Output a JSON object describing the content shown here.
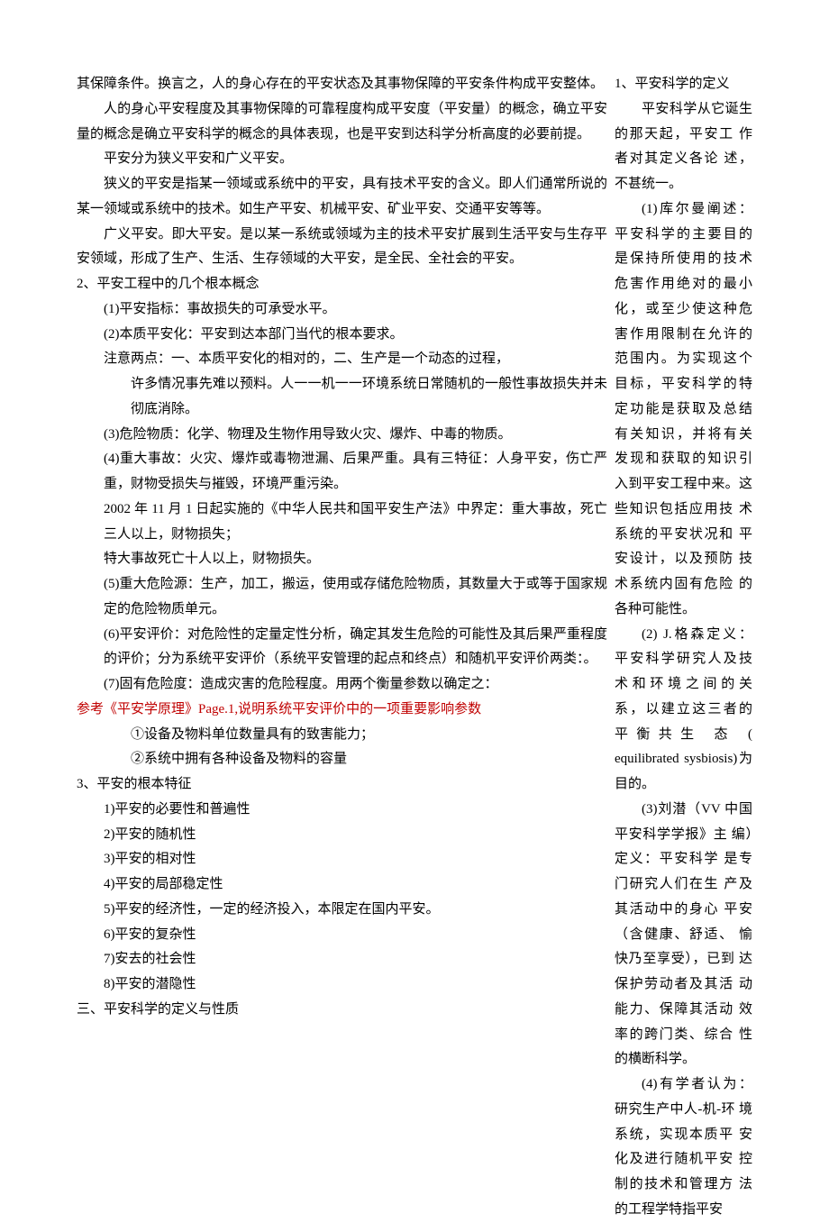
{
  "right": {
    "h1": "1、平安科学的定义",
    "p1": "平安科学从它诞生的那天起，平安工 作者对其定义各论 述，不甚统一。",
    "p2": "(1)库尔曼阐述： 平安科学的主要目的 是保持所使用的技术 危害作用绝对的最小 化，或至少使这种危 害作用限制在允许的 范围内。为实现这个 目标，平安科学的特 定功能是获取及总结 有关知识，并将有关 发现和获取的知识引 入到平安工程中来。这些知识包括应用技 术系统的平安状况和 平安设计，以及预防 技术系统内固有危险 的各种可能性。",
    "p3": "(2) J.格森定义： 平安科学研究人及技 术和环境之间的关 系，以建立这三者的 平衡共生 态 ( equilibrated sysbiosis)为目的。",
    "p4": "(3)刘潜（VV 中国 平安科学学报》主 编）定义：平安科学 是专门研究人们在生 产及其活动中的身心 平安（含健康、舒适、 愉快乃至享受），已到 达保护劳动者及其活 动能力、保障其活动 效率的跨门类、综合 性的横断科学。",
    "p5": "(4)有学者认为： 研究生产中人-机-环 境系统，实现本质平 安化及进行随机平安 控制的技术和管理方 法的工程学特指平安"
  },
  "left": {
    "p1": "其保障条件。换言之，人的身心存在的平安状态及其事物保障的平安条件构成平安整体。",
    "p2": "人的身心平安程度及其事物保障的可靠程度构成平安度（平安量）的概念，确立平安量的概念是确立平安科学的概念的具体表现，也是平安到达科学分析高度的必要前提。",
    "p3": "平安分为狭义平安和广义平安。",
    "p4": "狭义的平安是指某一领域或系统中的平安，具有技术平安的含义。即人们通常所说的某一领域或系统中的技术。如生产平安、机械平安、矿业平安、交通平安等等。",
    "p5": "广义平安。即大平安。是以某一系统或领域为主的技术平安扩展到生活平安与生存平安领域，形成了生产、生活、生存领域的大平安，是全民、全社会的平安。",
    "h2": "2、平安工程中的几个根本概念",
    "i1": "(1)平安指标：事故损失的可承受水平。",
    "i2": "(2)本质平安化：平安到达本部门当代的根本要求。",
    "i2a": "注意两点：一、本质平安化的相对的，二、生产是一个动态的过程，",
    "i2b": "许多情况事先难以预料。人一一机一一环境系统日常随机的一般性事故损失并未彻底消除。",
    "i3": "(3)危险物质：化学、物理及生物作用导致火灾、爆炸、中毒的物质。",
    "i4": "(4)重大事故：火灾、爆炸或毒物泄漏、后果严重。具有三特征：人身平安，伤亡严重，财物受损失与摧毁，环境严重污染。",
    "i4a": "2002 年 11 月 1 日起实施的《中华人民共和国平安生产法》中界定：重大事故，死亡三人以上，财物损失；",
    "i4b": "特大事故死亡十人以上，财物损失。",
    "i5": "(5)重大危险源：生产，加工，搬运，使用或存储危险物质，其数量大于或等于国家规定的危险物质单元。",
    "i6": "(6)平安评价：对危险性的定量定性分析，确定其发生危险的可能性及其后果严重程度的评价；分为系统平安评价（系统平安管理的起点和终点）和随机平安评价两类：。",
    "i7": "(7)固有危险度：造成灾害的危险程度。用两个衡量参数以确定之：",
    "red": "参考《平安学原理》Page.1,说明系统平安评价中的一项重要影响参数",
    "i7a": "①设备及物料单位数量具有的致害能力；",
    "i7b": "②系统中拥有各种设备及物料的容量",
    "h3": "3、平安的根本特征",
    "c1": "1)平安的必要性和普遍性",
    "c2": "2)平安的随机性",
    "c3": "3)平安的相对性",
    "c4": "4)平安的局部稳定性",
    "c5": "5)平安的经济性，一定的经济投入，本限定在国内平安。",
    "c6": "6)平安的复杂性",
    "c7": "7)安去的社会性",
    "c8": "8)平安的潜隐性",
    "sec3": "三、平安科学的定义与性质"
  }
}
